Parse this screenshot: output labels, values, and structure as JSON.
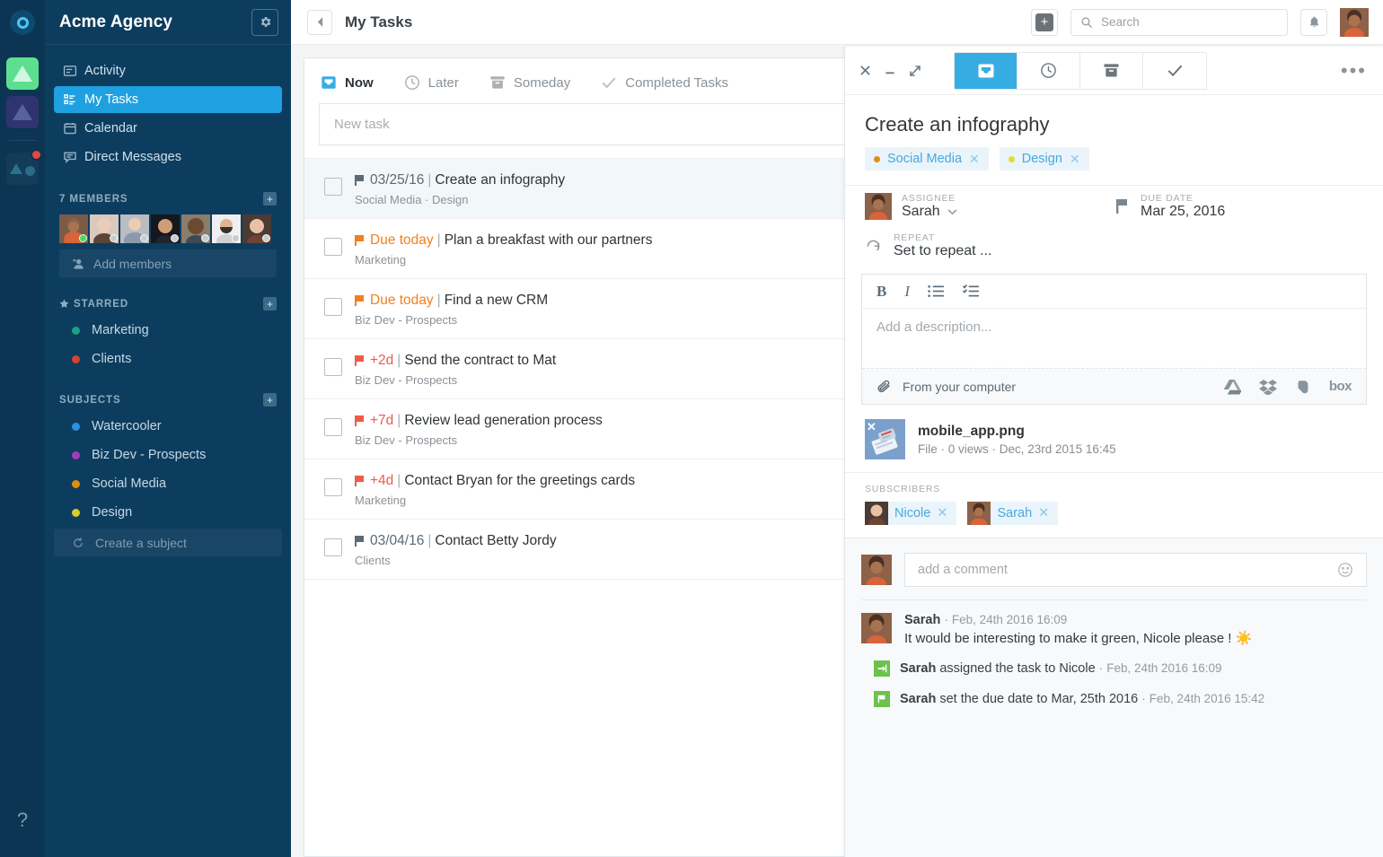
{
  "rail": {
    "logo_icon": "circle-logo-icon",
    "apps": [
      {
        "name": "app-green",
        "icon": "triangle-icon",
        "color": "#5ce08f",
        "badge": false
      },
      {
        "name": "app-purple",
        "icon": "triangle-icon",
        "color": "#2f3470",
        "badge": false
      },
      {
        "name": "app-dark",
        "icon": "triangle-circle-icon",
        "color": "#123c58",
        "badge": true
      }
    ],
    "help_label": "?"
  },
  "sidebar": {
    "title": "Acme Agency",
    "gear_icon": "gear-icon",
    "nav": [
      {
        "label": "Activity",
        "icon": "activity-icon",
        "active": false
      },
      {
        "label": "My Tasks",
        "icon": "tasks-icon",
        "active": true
      },
      {
        "label": "Calendar",
        "icon": "calendar-icon",
        "active": false
      },
      {
        "label": "Direct Messages",
        "icon": "messages-icon",
        "active": false
      }
    ],
    "members": {
      "heading": "7 MEMBERS",
      "count": 7,
      "add_label": "Add members",
      "add_icon": "add-person-icon",
      "avatars": [
        {
          "name": "member-1",
          "online": true
        },
        {
          "name": "member-2",
          "online": false
        },
        {
          "name": "member-3",
          "online": false
        },
        {
          "name": "member-4",
          "online": false
        },
        {
          "name": "member-5",
          "online": false
        },
        {
          "name": "member-6",
          "online": false
        },
        {
          "name": "member-7",
          "online": false
        }
      ]
    },
    "starred": {
      "heading": "STARRED",
      "star_icon": "star-icon",
      "items": [
        {
          "label": "Marketing",
          "color": "#1aa181"
        },
        {
          "label": "Clients",
          "color": "#d64331"
        }
      ]
    },
    "subjects": {
      "heading": "SUBJECTS",
      "items": [
        {
          "label": "Watercooler",
          "color": "#2f8fe0"
        },
        {
          "label": "Biz Dev - Prospects",
          "color": "#a23bb8"
        },
        {
          "label": "Social Media",
          "color": "#e08b12"
        },
        {
          "label": "Design",
          "color": "#d9cc2a"
        }
      ],
      "create_label": "Create a subject",
      "create_icon": "refresh-icon"
    }
  },
  "topbar": {
    "back_icon": "chevron-left-icon",
    "page_title": "My Tasks",
    "add_icon": "plus-icon",
    "search_placeholder": "Search",
    "search_icon": "search-icon",
    "search_value": "",
    "bell_icon": "bell-icon",
    "avatar_name": "user-avatar"
  },
  "tasklist": {
    "tabs": [
      {
        "label": "Now",
        "icon": "inbox-icon",
        "active": true
      },
      {
        "label": "Later",
        "icon": "clock-icon",
        "active": false
      },
      {
        "label": "Someday",
        "icon": "archive-icon",
        "active": false
      },
      {
        "label": "Completed Tasks",
        "icon": "check-icon",
        "active": false
      }
    ],
    "new_task_placeholder": "New task",
    "rows": [
      {
        "due": "03/25/16",
        "due_color": "#5c6a74",
        "title": "Create an infography",
        "subjects": "Social Media · Design",
        "selected": true
      },
      {
        "due": "Due today",
        "due_color": "#f08020",
        "title": "Plan a breakfast with our partners",
        "subjects": "Marketing",
        "selected": false
      },
      {
        "due": "Due today",
        "due_color": "#f08020",
        "title": "Find a new CRM",
        "subjects": "Biz Dev - Prospects",
        "selected": false
      },
      {
        "due": "+2d",
        "due_color": "#ef5b4c",
        "title": "Send the contract to Mat",
        "subjects": "Biz Dev - Prospects",
        "selected": false
      },
      {
        "due": "+7d",
        "due_color": "#ef5b4c",
        "title": "Review lead generation process",
        "subjects": "Biz Dev - Prospects",
        "selected": false
      },
      {
        "due": "+4d",
        "due_color": "#ef5b4c",
        "title": "Contact Bryan for the greetings cards",
        "subjects": "Marketing",
        "selected": false
      },
      {
        "due": "03/04/16",
        "due_color": "#5c6a74",
        "title": "Contact Betty Jordy",
        "subjects": "Clients",
        "selected": false
      }
    ],
    "separator": "|"
  },
  "detail": {
    "window": {
      "close_icon": "close-icon",
      "minimize_icon": "minimize-icon",
      "expand_icon": "expand-icon",
      "more_icon": "more-dots-icon"
    },
    "tabs": [
      {
        "name": "tab-now",
        "icon": "inbox-icon",
        "active": true
      },
      {
        "name": "tab-later",
        "icon": "clock-icon",
        "active": false
      },
      {
        "name": "tab-someday",
        "icon": "archive-icon",
        "active": false
      },
      {
        "name": "tab-complete",
        "icon": "check-icon",
        "active": false
      }
    ],
    "title": "Create an infography",
    "tags": [
      {
        "label": "Social Media",
        "color": "#e08b12",
        "remove_icon": "close-icon"
      },
      {
        "label": "Design",
        "color": "#e8d92e",
        "remove_icon": "close-icon"
      }
    ],
    "assignee": {
      "label": "ASSIGNEE",
      "value": "Sarah",
      "chevron_icon": "chevron-down-icon"
    },
    "due_date": {
      "label": "DUE DATE",
      "value": "Mar 25, 2016",
      "flag_icon": "flag-icon"
    },
    "repeat": {
      "label": "REPEAT",
      "value": "Set to repeat ...",
      "icon": "repeat-icon"
    },
    "editor": {
      "tools": [
        {
          "name": "bold-button",
          "glyph": "B"
        },
        {
          "name": "italic-button",
          "glyph": "I"
        },
        {
          "name": "bullet-list-button",
          "glyph": "list-icon"
        },
        {
          "name": "checklist-button",
          "glyph": "checklist-icon"
        }
      ],
      "placeholder": "Add a description...",
      "value": "",
      "upload_label": "From your computer",
      "clip_icon": "paperclip-icon",
      "clouds": [
        {
          "name": "google-drive-icon",
          "label": "drive"
        },
        {
          "name": "dropbox-icon",
          "label": "dropbox"
        },
        {
          "name": "evernote-icon",
          "label": "evernote"
        },
        {
          "name": "box-icon",
          "label": "box"
        }
      ]
    },
    "attachment": {
      "filename": "mobile_app.png",
      "meta": "File · 0 views · Dec, 23rd 2015 16:45",
      "remove_icon": "close-icon"
    },
    "subscribers": {
      "label": "SUBSCRIBERS",
      "items": [
        {
          "name": "Nicole",
          "remove_icon": "close-icon"
        },
        {
          "name": "Sarah",
          "remove_icon": "close-icon"
        }
      ]
    },
    "comment_box": {
      "placeholder": "add a comment",
      "value": "",
      "emoji_icon": "smiley-icon"
    },
    "activity": [
      {
        "type": "comment",
        "author": "Sarah",
        "time": "Feb, 24th 2016 16:09",
        "text": "It would be interesting to make it green, Nicole please ! ☀️"
      },
      {
        "type": "event",
        "icon": "assign-icon",
        "icon_color": "#6cc24a",
        "author": "Sarah",
        "text": "assigned the task to Nicole",
        "time": "Feb, 24th 2016 16:09"
      },
      {
        "type": "event",
        "icon": "flag-icon",
        "icon_color": "#6cc24a",
        "author": "Sarah",
        "text": "set the due date to Mar, 25th 2016",
        "time": "Feb, 24th 2016 15:42"
      }
    ],
    "dot_separator": "·"
  },
  "colors": {
    "accent": "#36ade2",
    "sidebar_bg": "#0d3d5e",
    "rail_bg": "#0b3552",
    "nav_active": "#1fa0e0"
  }
}
